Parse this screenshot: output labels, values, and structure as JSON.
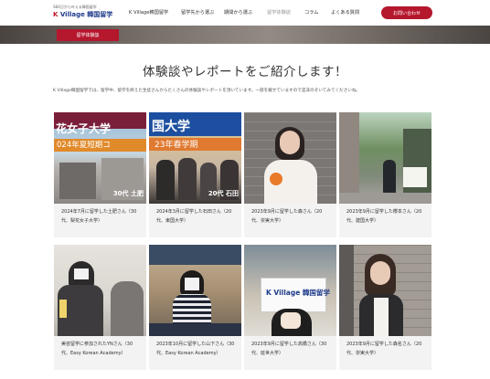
{
  "header": {
    "logo_tagline": "SB4日から叶える韓国留学",
    "logo_brand_k": "K",
    "logo_brand": "Village 韓国留学",
    "nav": [
      "K Village韓国留学",
      "留学先から選ぶ",
      "期間から選ぶ",
      "留学体験談",
      "コラム",
      "よくある質問"
    ],
    "cta_label": "お問い合わせ"
  },
  "hero": {
    "badge": "留学体験談"
  },
  "page": {
    "title": "体験談やレポートをご紹介します！",
    "description": "K Village韓国留学では、留学中、留学を終えた生徒さんからたくさんの体験談やレポートを頂いています。一部を載せていますので是非のぞいてみてくださいね。"
  },
  "cards": [
    {
      "caption": "2024年7月に留学した土肥さん（30代、梨花女子大学）",
      "photo_text": [
        "花女子大学",
        "024年夏短期コ"
      ],
      "photo_sub": "30代 土肥"
    },
    {
      "caption": "2024年3月に留学した石田さん（20代、東国大学）",
      "photo_text": [
        "国大学",
        "23年春学期"
      ],
      "photo_sub": "20代 石田"
    },
    {
      "caption": "2023年9月に留学した森さん（20代、崇実大学）",
      "photo_text": [],
      "photo_sub": ""
    },
    {
      "caption": "2023年9月に留学した櫻本さん（20代、建国大学）",
      "photo_text": [],
      "photo_sub": ""
    },
    {
      "caption": "美容留学に参加されたYNさん（30代、Easy Korean Academy）",
      "photo_text": [],
      "photo_sub": ""
    },
    {
      "caption": "2023年10月に留学した山下さん（30代、Easy Korean Academy）",
      "photo_text": [],
      "photo_sub": ""
    },
    {
      "caption": "2023年9月に留学した高橋さん（30代、延世大学）",
      "photo_text": [
        "K Village 韓国留学"
      ],
      "photo_sub": ""
    },
    {
      "caption": "2023年9月に留学した森名さん（20代、崇実大学）",
      "photo_text": [],
      "photo_sub": ""
    }
  ],
  "colors": {
    "accent": "#b5172d",
    "brand_blue": "#1d3a8a"
  }
}
